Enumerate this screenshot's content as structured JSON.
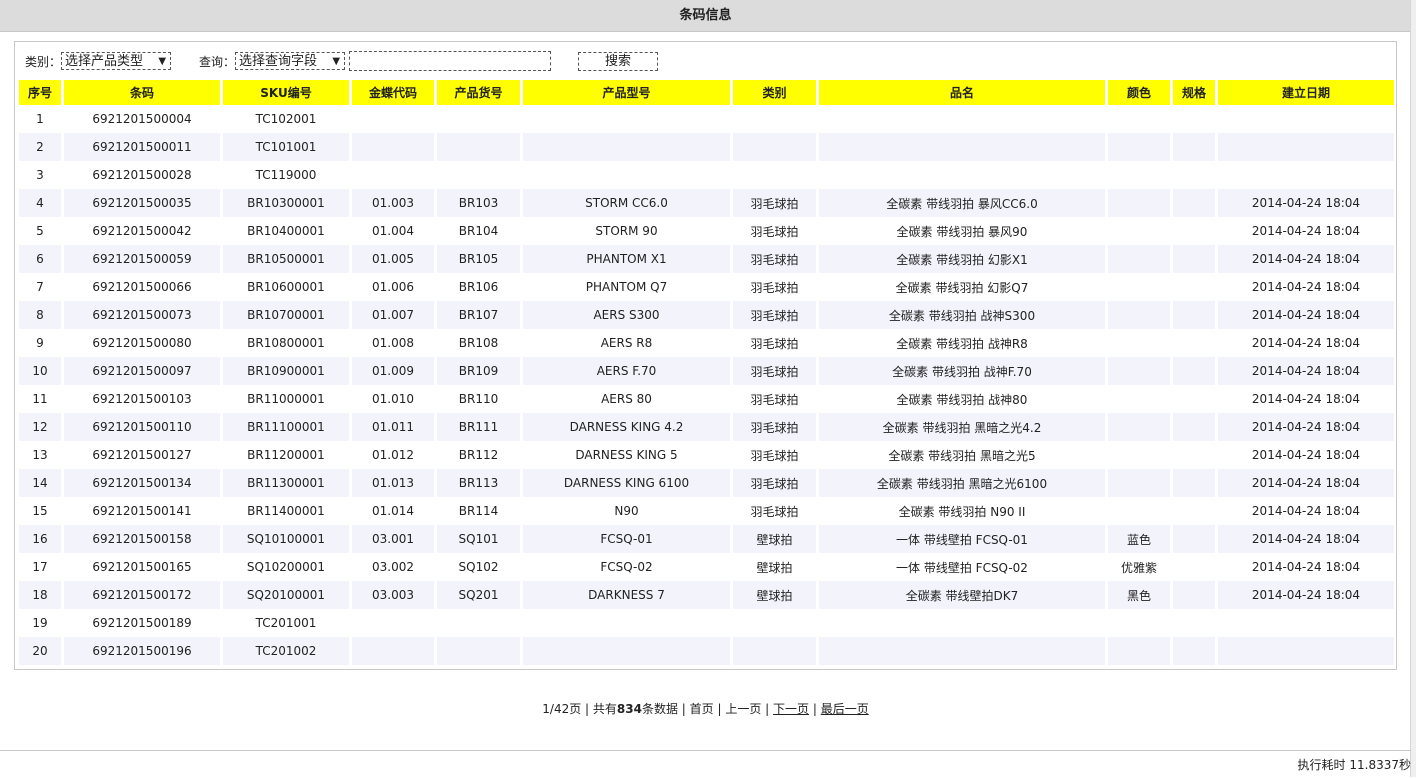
{
  "header": {
    "title": "条码信息"
  },
  "filters": {
    "category_label": "类别：",
    "category_select": "选择产品类型",
    "query_label": "查询：",
    "query_select": "选择查询字段",
    "query_input_value": "",
    "search_button": "搜索"
  },
  "table": {
    "columns": [
      "序号",
      "条码",
      "SKU编号",
      "金蝶代码",
      "产品货号",
      "产品型号",
      "类别",
      "品名",
      "颜色",
      "规格",
      "建立日期"
    ],
    "rows": [
      [
        "1",
        "6921201500004",
        "TC102001",
        "",
        "",
        "",
        "",
        "",
        "",
        "",
        ""
      ],
      [
        "2",
        "6921201500011",
        "TC101001",
        "",
        "",
        "",
        "",
        "",
        "",
        "",
        ""
      ],
      [
        "3",
        "6921201500028",
        "TC119000",
        "",
        "",
        "",
        "",
        "",
        "",
        "",
        ""
      ],
      [
        "4",
        "6921201500035",
        "BR10300001",
        "01.003",
        "BR103",
        "STORM CC6.0",
        "羽毛球拍",
        "全碳素 带线羽拍 暴风CC6.0",
        "",
        "",
        "2014-04-24 18:04"
      ],
      [
        "5",
        "6921201500042",
        "BR10400001",
        "01.004",
        "BR104",
        "STORM 90",
        "羽毛球拍",
        "全碳素 带线羽拍 暴风90",
        "",
        "",
        "2014-04-24 18:04"
      ],
      [
        "6",
        "6921201500059",
        "BR10500001",
        "01.005",
        "BR105",
        "PHANTOM X1",
        "羽毛球拍",
        "全碳素 带线羽拍 幻影X1",
        "",
        "",
        "2014-04-24 18:04"
      ],
      [
        "7",
        "6921201500066",
        "BR10600001",
        "01.006",
        "BR106",
        "PHANTOM Q7",
        "羽毛球拍",
        "全碳素 带线羽拍 幻影Q7",
        "",
        "",
        "2014-04-24 18:04"
      ],
      [
        "8",
        "6921201500073",
        "BR10700001",
        "01.007",
        "BR107",
        "AERS S300",
        "羽毛球拍",
        "全碳素 带线羽拍 战神S300",
        "",
        "",
        "2014-04-24 18:04"
      ],
      [
        "9",
        "6921201500080",
        "BR10800001",
        "01.008",
        "BR108",
        "AERS R8",
        "羽毛球拍",
        "全碳素 带线羽拍 战神R8",
        "",
        "",
        "2014-04-24 18:04"
      ],
      [
        "10",
        "6921201500097",
        "BR10900001",
        "01.009",
        "BR109",
        "AERS F.70",
        "羽毛球拍",
        "全碳素 带线羽拍 战神F.70",
        "",
        "",
        "2014-04-24 18:04"
      ],
      [
        "11",
        "6921201500103",
        "BR11000001",
        "01.010",
        "BR110",
        "AERS 80",
        "羽毛球拍",
        "全碳素 带线羽拍 战神80",
        "",
        "",
        "2014-04-24 18:04"
      ],
      [
        "12",
        "6921201500110",
        "BR11100001",
        "01.011",
        "BR111",
        "DARNESS KING 4.2",
        "羽毛球拍",
        "全碳素 带线羽拍 黑暗之光4.2",
        "",
        "",
        "2014-04-24 18:04"
      ],
      [
        "13",
        "6921201500127",
        "BR11200001",
        "01.012",
        "BR112",
        "DARNESS KING 5",
        "羽毛球拍",
        "全碳素 带线羽拍 黑暗之光5",
        "",
        "",
        "2014-04-24 18:04"
      ],
      [
        "14",
        "6921201500134",
        "BR11300001",
        "01.013",
        "BR113",
        "DARNESS KING 6100",
        "羽毛球拍",
        "全碳素 带线羽拍 黑暗之光6100",
        "",
        "",
        "2014-04-24 18:04"
      ],
      [
        "15",
        "6921201500141",
        "BR11400001",
        "01.014",
        "BR114",
        "N90",
        "羽毛球拍",
        "全碳素 带线羽拍 N90 II",
        "",
        "",
        "2014-04-24 18:04"
      ],
      [
        "16",
        "6921201500158",
        "SQ10100001",
        "03.001",
        "SQ101",
        "FCSQ-01",
        "壁球拍",
        "一体 带线壁拍 FCSQ-01",
        "蓝色",
        "",
        "2014-04-24 18:04"
      ],
      [
        "17",
        "6921201500165",
        "SQ10200001",
        "03.002",
        "SQ102",
        "FCSQ-02",
        "壁球拍",
        "一体 带线壁拍 FCSQ-02",
        "优雅紫",
        "",
        "2014-04-24 18:04"
      ],
      [
        "18",
        "6921201500172",
        "SQ20100001",
        "03.003",
        "SQ201",
        "DARKNESS 7",
        "壁球拍",
        "全碳素 带线壁拍DK7",
        "黑色",
        "",
        "2014-04-24 18:04"
      ],
      [
        "19",
        "6921201500189",
        "TC201001",
        "",
        "",
        "",
        "",
        "",
        "",
        "",
        ""
      ],
      [
        "20",
        "6921201500196",
        "TC201002",
        "",
        "",
        "",
        "",
        "",
        "",
        "",
        ""
      ]
    ]
  },
  "pager": {
    "page_info": "1/42页",
    "sep": " | ",
    "total_prefix": "共有",
    "total_count": "834",
    "total_suffix": "条数据",
    "first": "首页",
    "prev": "上一页",
    "next": "下一页",
    "last": "最后一页"
  },
  "footer": {
    "exec_time": "执行耗时 11.8337秒"
  },
  "colors": {
    "header_bg": "#ffff00",
    "alt_row_bg": "#f3f3fb",
    "titlebar_bg": "#dcdcdc"
  }
}
